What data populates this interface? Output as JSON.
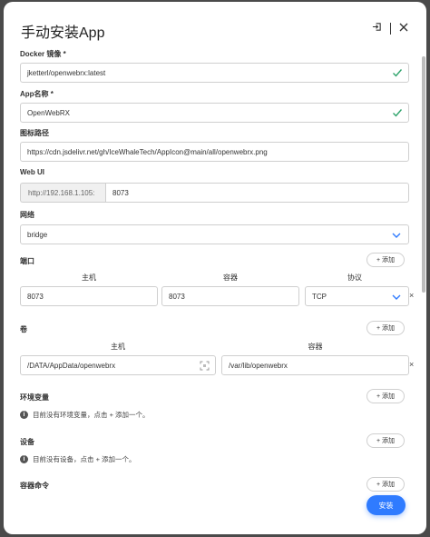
{
  "dialog": {
    "title": "手动安装App"
  },
  "fields": {
    "docker_image": {
      "label": "Docker 镜像 *",
      "value": "jketterl/openwebrx:latest"
    },
    "app_name": {
      "label": "App名称 *",
      "value": "OpenWebRX"
    },
    "icon_path": {
      "label": "图标路径",
      "value": "https://cdn.jsdelivr.net/gh/IceWhaleTech/AppIcon@main/all/openwebrx.png"
    },
    "web_ui": {
      "label": "Web UI",
      "prefix": "http://192.168.1.105:",
      "port": "8073"
    },
    "network": {
      "label": "网络",
      "value": "bridge"
    }
  },
  "ports": {
    "label": "端口",
    "add_label": "添加",
    "col_host": "主机",
    "col_container": "容器",
    "col_protocol": "协议",
    "rows": [
      {
        "host": "8073",
        "container": "8073",
        "protocol": "TCP"
      }
    ]
  },
  "volumes": {
    "label": "卷",
    "add_label": "添加",
    "col_host": "主机",
    "col_container": "容器",
    "rows": [
      {
        "host": "/DATA/AppData/openwebrx",
        "container": "/var/lib/openwebrx"
      }
    ]
  },
  "env": {
    "label": "环境变量",
    "add_label": "添加",
    "empty_text": "目前没有环境变量，点击 + 添加一个。"
  },
  "devices": {
    "label": "设备",
    "add_label": "添加",
    "empty_text": "目前没有设备，点击 + 添加一个。"
  },
  "cmd": {
    "label": "容器命令",
    "add_label": "添加"
  },
  "install_label": "安装",
  "remove_symbol": "×",
  "colors": {
    "accent": "#2f7bff",
    "valid": "#2ea36b"
  }
}
